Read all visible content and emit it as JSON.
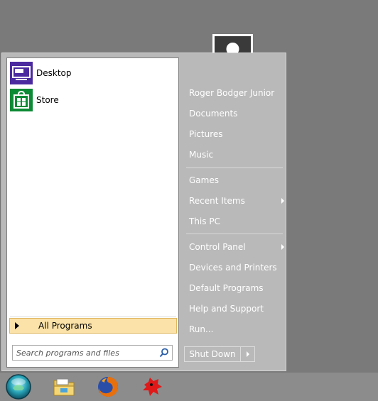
{
  "pinned": [
    {
      "label": "Desktop",
      "icon": "desktop-tile-icon"
    },
    {
      "label": "Store",
      "icon": "store-tile-icon"
    }
  ],
  "all_programs_label": "All Programs",
  "search": {
    "placeholder": "Search programs and files"
  },
  "right_menu": {
    "user_name": "Roger Bodger Junior",
    "documents": "Documents",
    "pictures": "Pictures",
    "music": "Music",
    "games": "Games",
    "recent_items": "Recent Items",
    "this_pc": "This PC",
    "control_panel": "Control Panel",
    "devices_printers": "Devices and Printers",
    "default_programs": "Default Programs",
    "help_support": "Help and Support",
    "run": "Run..."
  },
  "shutdown_label": "Shut Down",
  "taskbar": {
    "items": [
      "start-orb-icon",
      "file-explorer-icon",
      "firefox-icon",
      "red-app-icon"
    ]
  },
  "colors": {
    "menu_bg": "#b9b9b9",
    "desktop_tile": "#4b2aa0",
    "store_tile": "#0d8a35",
    "highlight": "#fbe2a8"
  }
}
